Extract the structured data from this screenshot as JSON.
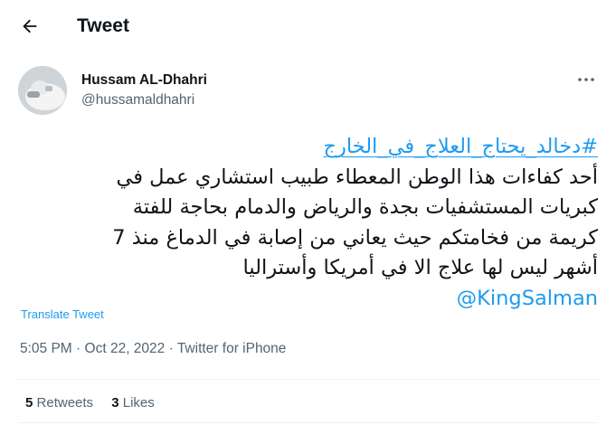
{
  "header": {
    "title": "Tweet"
  },
  "author": {
    "name": "Hussam AL-Dhahri",
    "handle": "@hussamaldhahri"
  },
  "tweet": {
    "hashtag": "#دخالد_يحتاج_العلاج_في_الخارج",
    "lines": [
      "أحد كفاءات هذا الوطن المعطاء طبيب استشاري عمل في",
      "كبريات المستشفيات بجدة والرياض والدمام بحاجة للفتة",
      "كريمة من فخامتكم حيث يعاني من إصابة في الدماغ منذ 7",
      "أشهر ليس لها علاج الا في أمريكا وأستراليا"
    ],
    "mention": "@KingSalman"
  },
  "translate_label": "Translate Tweet",
  "meta": {
    "time": "5:05 PM",
    "sep1": "·",
    "date": "Oct 22, 2022",
    "sep2": "·",
    "source": "Twitter for iPhone"
  },
  "stats": {
    "retweets_count": "5",
    "retweets_label": "Retweets",
    "likes_count": "3",
    "likes_label": "Likes"
  },
  "colors": {
    "link": "#1d9bf0",
    "secondary_text": "#536471",
    "primary_text": "#0f1419",
    "divider": "#eff3f4"
  },
  "icons": {
    "back": "arrow-left-icon",
    "more": "more-horizontal-icon"
  }
}
